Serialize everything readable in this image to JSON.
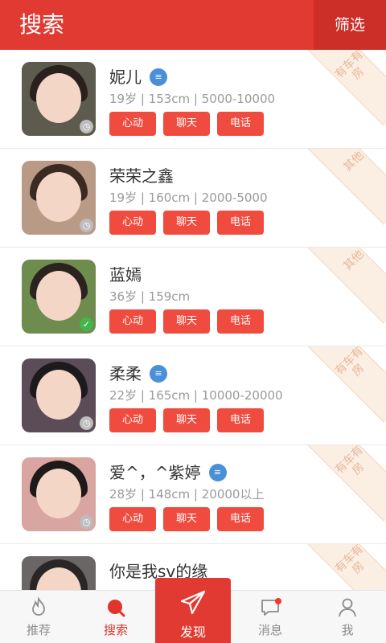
{
  "header": {
    "title": "搜索",
    "filter_label": "筛选"
  },
  "buttons": {
    "like": "心动",
    "chat": "聊天",
    "call": "电话"
  },
  "users": [
    {
      "name": "妮儿",
      "info": "19岁 | 153cm | 5000-10000",
      "verified_icon": "id-card-icon",
      "status_icon": "clock-icon",
      "tag": "有车有房",
      "avatar_bg": "#5d5a4e"
    },
    {
      "name": "荣荣之鑫",
      "info": "19岁 | 160cm | 2000-5000",
      "verified_icon": null,
      "status_icon": "clock-icon",
      "tag": "其他",
      "avatar_bg": "#b99a86"
    },
    {
      "name": "蓝嫣",
      "info": "36岁 | 159cm",
      "verified_icon": null,
      "status_icon": "check-icon",
      "tag": "其他",
      "avatar_bg": "#6f8c4f"
    },
    {
      "name": "柔柔",
      "info": "22岁 | 165cm | 10000-20000",
      "verified_icon": "id-card-icon",
      "status_icon": "clock-icon",
      "tag": "有车有房",
      "avatar_bg": "#5b4c57"
    },
    {
      "name": "爱^，^紫婷",
      "info": "28岁 | 148cm | 20000以上",
      "verified_icon": "id-card-icon",
      "status_icon": "clock-icon",
      "tag": "有车有房",
      "avatar_bg": "#d9a5a0"
    },
    {
      "name": "你是我sv的缘",
      "info": "",
      "verified_icon": null,
      "status_icon": null,
      "tag": "有车有房",
      "avatar_bg": "#6a6665"
    }
  ],
  "bottom_nav": {
    "items": [
      {
        "label": "推荐",
        "icon": "flame-icon"
      },
      {
        "label": "搜索",
        "icon": "search-icon"
      },
      {
        "label": "发现",
        "icon": "paper-plane-icon"
      },
      {
        "label": "消息",
        "icon": "message-icon"
      },
      {
        "label": "我",
        "icon": "person-icon"
      }
    ]
  },
  "colors": {
    "brand_red": "#e03a32",
    "button_red": "#f04b3f",
    "tag_text": "#e7b89a",
    "id_blue": "#4a90d9"
  }
}
